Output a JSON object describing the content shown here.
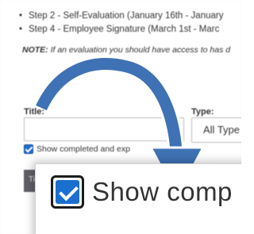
{
  "background_page": {
    "steps": [
      "Step 2 - Self-Evaluation (January 16th - January",
      "Step 4 - Employee Signature (March 1st - Marc"
    ],
    "note_label": "NOTE:",
    "note_text": " If an evaluation you should have access to has d",
    "title_label": "Title:",
    "type_label": "Type:",
    "type_select_value": "All Type",
    "show_completed_label": "Show completed and exp",
    "table_header_first": "Title"
  },
  "zoom_callout": {
    "label": "Show comp",
    "checked": true
  },
  "colors": {
    "arrow": "#3f72b4",
    "checkbox": "#1a6fd0",
    "header_strip": "#5f6066"
  },
  "icons": {
    "arrow": "curved-arrow-icon",
    "checkmark": "checkmark-icon"
  }
}
